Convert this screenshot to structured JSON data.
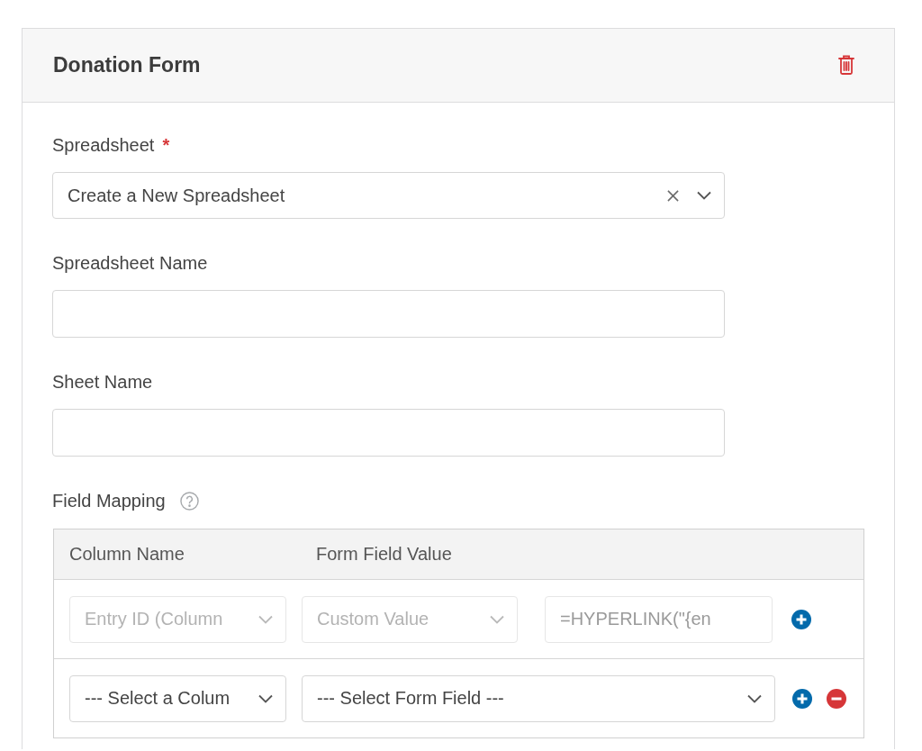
{
  "card": {
    "title": "Donation Form"
  },
  "fields": [
    {
      "kind": "select",
      "label": "Spreadsheet",
      "required_mark": "*",
      "value": "Create a New Spreadsheet",
      "clearable": true
    },
    {
      "kind": "text",
      "label": "Spreadsheet Name"
    },
    {
      "kind": "text",
      "label": "Sheet Name"
    }
  ],
  "field_mapping": {
    "label": "Field Mapping",
    "columns": [
      "Column Name",
      "Form Field Value"
    ],
    "rows": [
      {
        "disabled": true,
        "column": "Entry ID (Column",
        "source": "Custom Value",
        "custom_value": "=HYPERLINK(\"{en",
        "removable": false
      },
      {
        "disabled": false,
        "column": "--- Select a Colum",
        "source": "--- Select Form Field ---",
        "removable": true
      }
    ]
  }
}
